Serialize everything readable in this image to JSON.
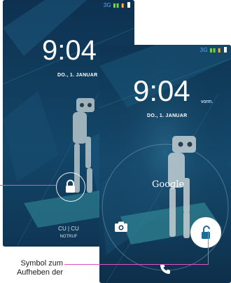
{
  "back_screen": {
    "status_text": "3G",
    "time": "9:04",
    "date": "DO., 1. JANUAR",
    "footer_top": "CU | CU",
    "footer_bottom": "NOTRUF"
  },
  "front_screen": {
    "status_text": "3G",
    "time": "9:04",
    "time_suffix": "vorm.",
    "date": "DO., 1. JANUAR",
    "google_label": "Google",
    "icons": [
      "camera-icon",
      "unlock-icon",
      "phone-icon"
    ]
  },
  "callout": {
    "text_line1": "Symbol zum",
    "text_line2": "Aufheben der"
  },
  "colors": {
    "screen_bg": "#123a57",
    "callout_line": "#e052c6",
    "unlock_icon": "#1a6d96"
  }
}
